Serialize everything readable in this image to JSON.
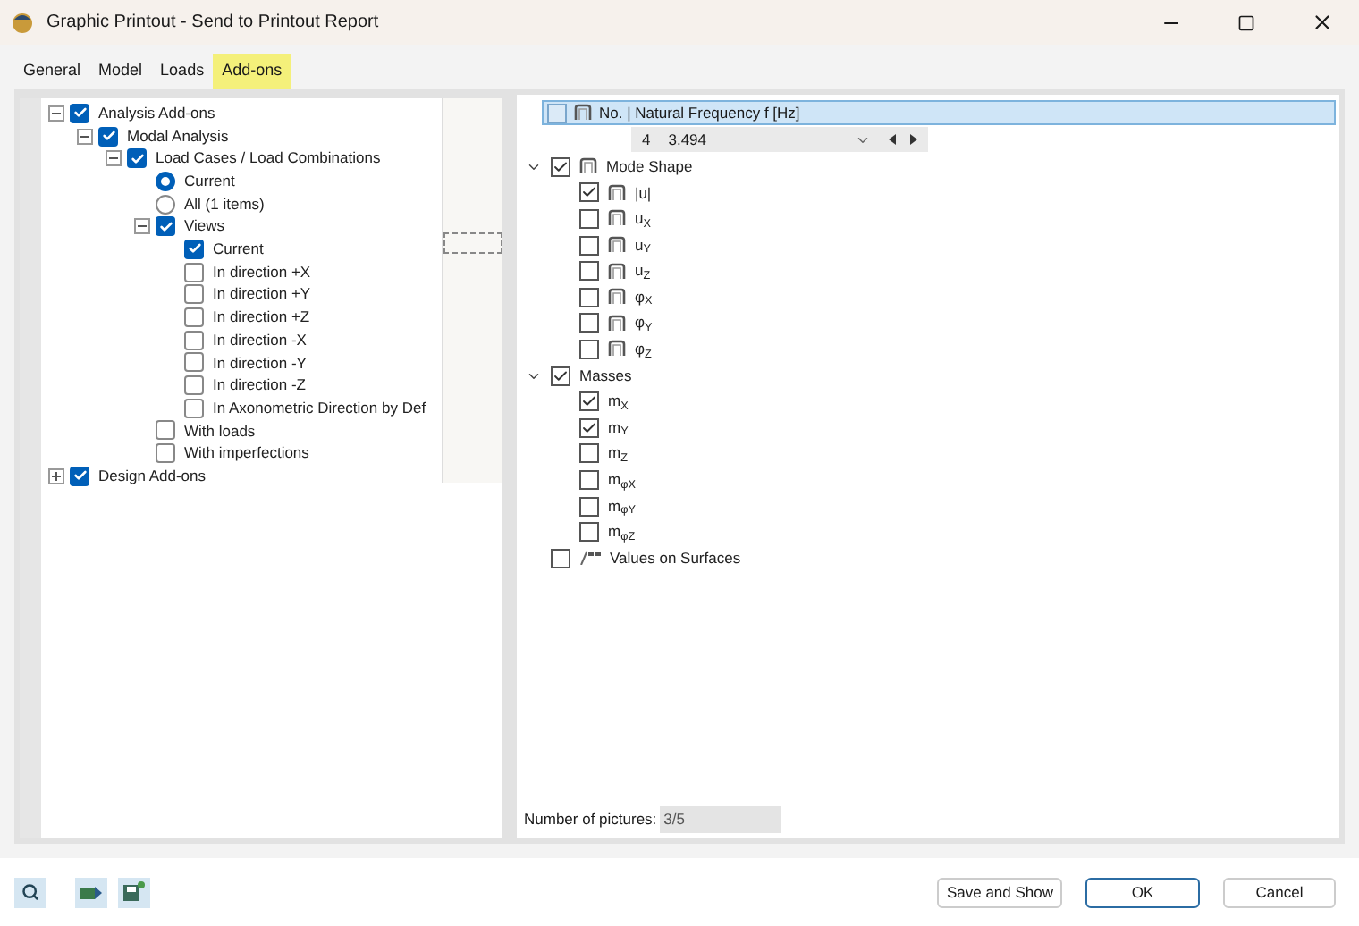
{
  "window": {
    "title": "Graphic Printout - Send to Printout Report"
  },
  "tabs": [
    {
      "label": "General",
      "selected": false
    },
    {
      "label": "Model",
      "selected": false
    },
    {
      "label": "Loads",
      "selected": false
    },
    {
      "label": "Add-ons",
      "selected": true
    }
  ],
  "tree": [
    {
      "label": "Analysis Add-ons",
      "kind": "checkbox",
      "checked": true,
      "expanded": true,
      "children": [
        {
          "label": "Modal Analysis",
          "kind": "checkbox",
          "checked": true,
          "expanded": true,
          "children": [
            {
              "label": "Load Cases / Load Combinations",
              "kind": "checkbox",
              "checked": true,
              "expanded": true,
              "children": [
                {
                  "label": "Current",
                  "kind": "radio",
                  "checked": true
                },
                {
                  "label": "All (1 items)",
                  "kind": "radio",
                  "checked": false
                },
                {
                  "label": "Views",
                  "kind": "checkbox",
                  "checked": true,
                  "expanded": true,
                  "children": [
                    {
                      "label": "Current",
                      "kind": "checkbox",
                      "checked": true
                    },
                    {
                      "label": "In direction +X",
                      "kind": "checkbox",
                      "checked": false
                    },
                    {
                      "label": "In direction +Y",
                      "kind": "checkbox",
                      "checked": false
                    },
                    {
                      "label": "In direction +Z",
                      "kind": "checkbox",
                      "checked": false
                    },
                    {
                      "label": "In direction -X",
                      "kind": "checkbox",
                      "checked": false
                    },
                    {
                      "label": "In direction -Y",
                      "kind": "checkbox",
                      "checked": false
                    },
                    {
                      "label": "In direction -Z",
                      "kind": "checkbox",
                      "checked": false
                    },
                    {
                      "label": "In Axonometric Direction by Def",
                      "kind": "checkbox",
                      "checked": false
                    }
                  ]
                },
                {
                  "label": "With loads",
                  "kind": "checkbox",
                  "checked": false
                },
                {
                  "label": "With imperfections",
                  "kind": "checkbox",
                  "checked": false
                }
              ]
            }
          ]
        }
      ]
    },
    {
      "label": "Design Add-ons",
      "kind": "checkbox",
      "checked": true,
      "expanded": false
    }
  ],
  "results": {
    "header": {
      "label": "No. | Natural Frequency f [Hz]",
      "checked": false,
      "selected": true
    },
    "mode_selector": {
      "number": "4",
      "value": "3.494"
    },
    "items": [
      {
        "label": "Mode Shape",
        "kind": "result",
        "checked": true,
        "expanded": true,
        "children": [
          {
            "label": "|u|",
            "kind": "result",
            "checked": true
          },
          {
            "label": "u$_{X}$",
            "kind": "result",
            "checked": false
          },
          {
            "label": "u$_{Y}$",
            "kind": "result",
            "checked": false
          },
          {
            "label": "u$_{Z}$",
            "kind": "result",
            "checked": false
          },
          {
            "label": "φ$_{X}$",
            "kind": "result",
            "checked": false
          },
          {
            "label": "φ$_{Y}$",
            "kind": "result",
            "checked": false
          },
          {
            "label": "φ$_{Z}$",
            "kind": "result",
            "checked": false
          }
        ]
      },
      {
        "label": "Masses",
        "kind": "plain",
        "checked": true,
        "expanded": true,
        "children": [
          {
            "label": "m$_{X}$",
            "kind": "plain",
            "checked": true
          },
          {
            "label": "m$_{Y}$",
            "kind": "plain",
            "checked": true
          },
          {
            "label": "m$_{Z}$",
            "kind": "plain",
            "checked": false
          },
          {
            "label": "m$_{φX}$",
            "kind": "plain",
            "checked": false
          },
          {
            "label": "m$_{φY}$",
            "kind": "plain",
            "checked": false
          },
          {
            "label": "m$_{φZ}$",
            "kind": "plain",
            "checked": false
          }
        ]
      },
      {
        "label": "Values on Surfaces",
        "kind": "surface",
        "checked": false
      }
    ],
    "pictures": {
      "label": "Number of pictures:",
      "value": "3/5"
    }
  },
  "footer": {
    "buttons": [
      {
        "label": "Save and Show",
        "kind": "normal"
      },
      {
        "label": "OK",
        "kind": "primary"
      },
      {
        "label": "Cancel",
        "kind": "normal"
      }
    ]
  }
}
